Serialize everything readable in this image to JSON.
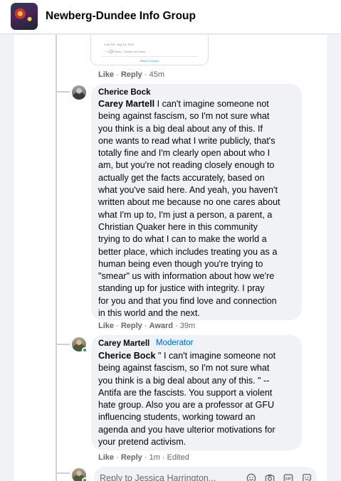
{
  "header": {
    "group_name": "Newberg-Dundee Info Group"
  },
  "quoted_card": {
    "meta": "2:56 PM · Aug 15, 2020",
    "actions": "♡ 0   💬 Reply   ↑ Share this Tweet",
    "replies_link": "Read 2 replies"
  },
  "prev_comment_actions": {
    "like": "Like",
    "reply": "Reply",
    "time": "45m"
  },
  "comments": [
    {
      "author": "Cherice Bock",
      "mention": "Carey Martell",
      "lines": [
        " I can't imagine someone not",
        "being against fascism, so I'm not sure what",
        "you think is a big deal about any of this. If",
        "one wants to read what I write publicly, that's",
        "totally fine and I'm clearly open about who I",
        "am, but you're not reading closely enough to",
        "actually get the facts accurately, based on",
        "what you've said here. And yeah, you haven't",
        "written about me because no one cares about",
        "what I'm up to, I'm just a person, a parent, a",
        "Christian Quaker here in this community",
        "trying to do what I can to make the world a",
        "better place, which includes treating you as a",
        "human being even though you're trying to",
        "\"smear\" us with information about how we're",
        "standing up for justice with integrity. I pray",
        "for you and that you find love and connection",
        "in this world and the next."
      ],
      "actions": {
        "like": "Like",
        "reply": "Reply",
        "award": "Award",
        "time": "39m"
      }
    },
    {
      "author": "Carey Martell",
      "badge": "Moderator",
      "mention": "Cherice Bock",
      "lines": [
        " \" I can't imagine someone not",
        "being against fascism, so I'm not sure what",
        "you think is a big deal about any of this. \" --",
        "Antifa are the fascists. You support a violent",
        "hate group. Also you are a professor at GFU",
        "influencing students, working toward an",
        "agenda and you have ulterior motivations for",
        "your pretend activism."
      ],
      "actions": {
        "like": "Like",
        "reply": "Reply",
        "time": "1m",
        "edited": "Edited"
      }
    }
  ],
  "reply_box": {
    "placeholder": "Reply to Jessica Harrington..."
  },
  "icons": [
    "smile-icon",
    "camera-icon",
    "gif-icon",
    "sticker-icon"
  ],
  "colors": {
    "bubble": "#f0f2f5",
    "meta": "#65676b",
    "online": "#31a24c",
    "badge_text": "#0064d1"
  }
}
